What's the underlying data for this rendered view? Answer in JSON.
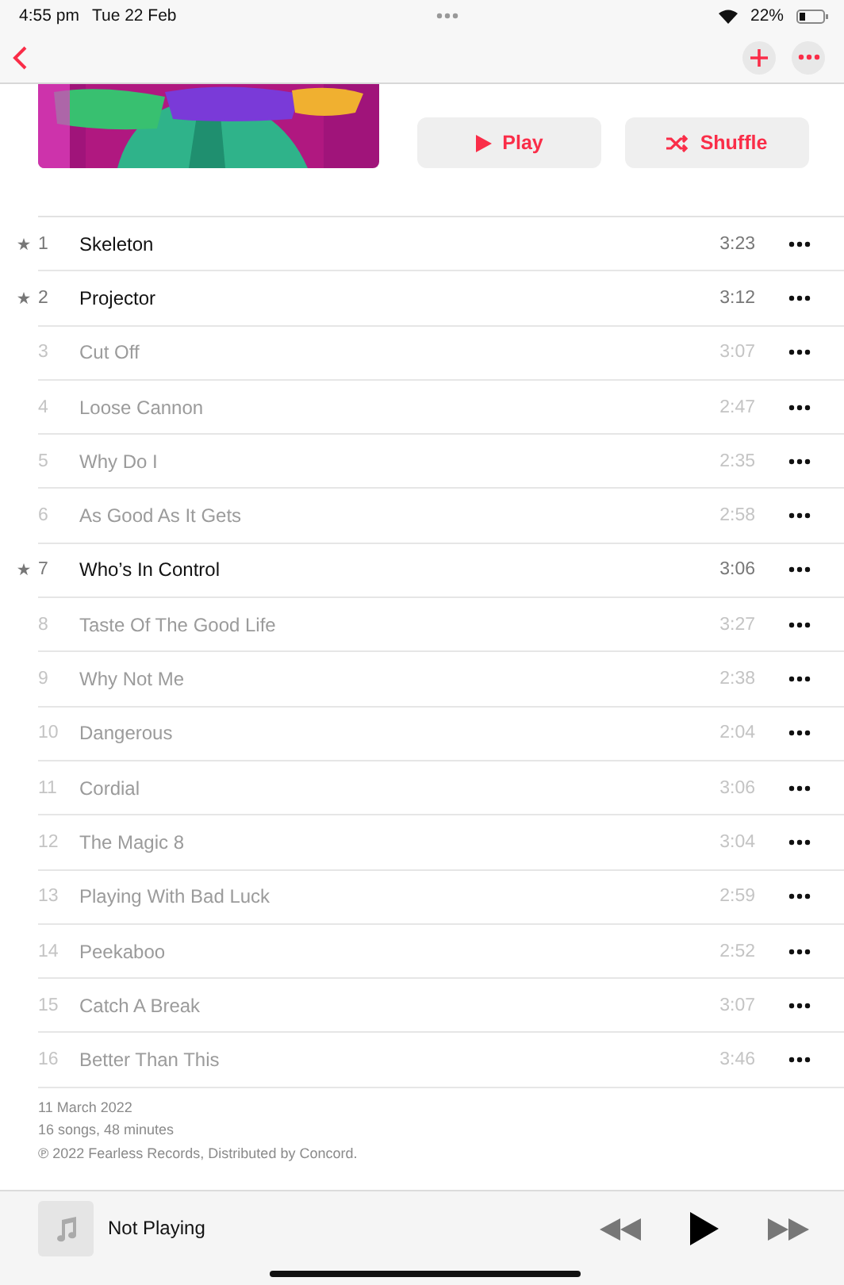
{
  "status_bar": {
    "time": "4:55 pm",
    "date": "Tue 22 Feb",
    "battery": "22%"
  },
  "actions": [
    {
      "label": "Play",
      "kind": "play"
    },
    {
      "label": "Shuffle",
      "kind": "shuffle"
    }
  ],
  "tracks": [
    {
      "number": "1",
      "title": "Skeleton",
      "duration": "3:23",
      "popular": true,
      "available": true
    },
    {
      "number": "2",
      "title": "Projector",
      "duration": "3:12",
      "popular": true,
      "available": true
    },
    {
      "number": "3",
      "title": "Cut Off",
      "duration": "3:07",
      "popular": false,
      "available": false
    },
    {
      "number": "4",
      "title": "Loose Cannon",
      "duration": "2:47",
      "popular": false,
      "available": false
    },
    {
      "number": "5",
      "title": "Why Do I",
      "duration": "2:35",
      "popular": false,
      "available": false
    },
    {
      "number": "6",
      "title": "As Good As It Gets",
      "duration": "2:58",
      "popular": false,
      "available": false
    },
    {
      "number": "7",
      "title": "Who’s In Control",
      "duration": "3:06",
      "popular": true,
      "available": true
    },
    {
      "number": "8",
      "title": "Taste Of The Good Life",
      "duration": "3:27",
      "popular": false,
      "available": false
    },
    {
      "number": "9",
      "title": "Why Not Me",
      "duration": "2:38",
      "popular": false,
      "available": false
    },
    {
      "number": "10",
      "title": "Dangerous",
      "duration": "2:04",
      "popular": false,
      "available": false
    },
    {
      "number": "11",
      "title": "Cordial",
      "duration": "3:06",
      "popular": false,
      "available": false
    },
    {
      "number": "12",
      "title": "The Magic 8",
      "duration": "3:04",
      "popular": false,
      "available": false
    },
    {
      "number": "13",
      "title": "Playing With Bad Luck",
      "duration": "2:59",
      "popular": false,
      "available": false
    },
    {
      "number": "14",
      "title": "Peekaboo",
      "duration": "2:52",
      "popular": false,
      "available": false
    },
    {
      "number": "15",
      "title": "Catch A Break",
      "duration": "3:07",
      "popular": false,
      "available": false
    },
    {
      "number": "16",
      "title": "Better Than This",
      "duration": "3:46",
      "popular": false,
      "available": false
    }
  ],
  "footer": [
    "11 March 2022",
    "16 songs, 48 minutes",
    "℗ 2022 Fearless Records, Distributed by Concord."
  ],
  "player": {
    "title": "Not Playing"
  }
}
